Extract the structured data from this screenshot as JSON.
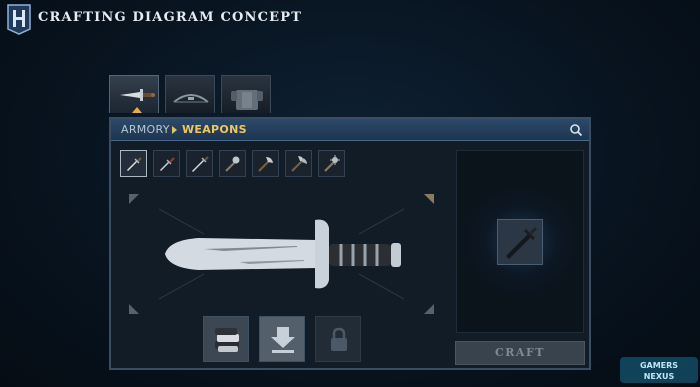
{
  "header": {
    "title": "CRAFTING DIAGRAM CONCEPT",
    "logo_icon": "hytale-h-logo-icon"
  },
  "category_tabs": [
    {
      "name": "weapons",
      "icon": "dagger-icon",
      "active": true
    },
    {
      "name": "bows",
      "icon": "bow-icon",
      "active": false
    },
    {
      "name": "armor",
      "icon": "armor-icon",
      "active": false
    }
  ],
  "panel": {
    "breadcrumb_root": "ARMORY",
    "breadcrumb_current": "WEAPONS",
    "search_icon": "search-icon"
  },
  "weapon_slots": [
    {
      "name": "dagger",
      "icon": "dagger-icon",
      "selected": true
    },
    {
      "name": "short-sword",
      "icon": "short-sword-icon",
      "selected": false
    },
    {
      "name": "sword",
      "icon": "sword-icon",
      "selected": false
    },
    {
      "name": "mace",
      "icon": "mace-icon",
      "selected": false
    },
    {
      "name": "battle-axe",
      "icon": "battle-axe-icon",
      "selected": false
    },
    {
      "name": "double-axe",
      "icon": "double-axe-icon",
      "selected": false
    },
    {
      "name": "spiked-mace",
      "icon": "spiked-mace-icon",
      "selected": false
    }
  ],
  "preview": {
    "item": "dagger",
    "icon": "dagger-silhouette-icon"
  },
  "material_slots": [
    {
      "name": "material",
      "icon": "stacked-materials-icon",
      "state": "filled"
    },
    {
      "name": "input",
      "icon": "download-arrow-icon",
      "state": "empty"
    },
    {
      "name": "locked",
      "icon": "lock-icon",
      "state": "locked"
    }
  ],
  "result": {
    "icon": "sword-result-icon"
  },
  "craft_button": {
    "label": "CRAFT",
    "enabled": false
  },
  "colors": {
    "accent": "#f0c75e",
    "panel_header": "#2c4a6a",
    "craft_disabled": "#39434d"
  },
  "watermark": {
    "text": "GAMERSNEXUS"
  }
}
